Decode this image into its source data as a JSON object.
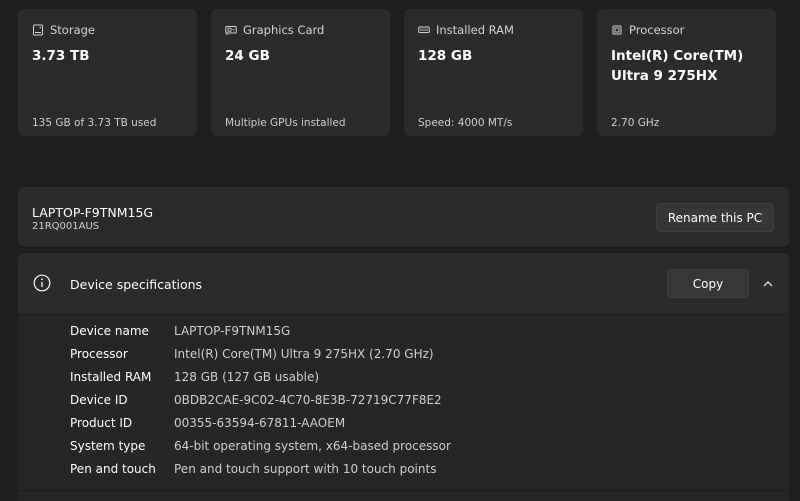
{
  "cards": [
    {
      "title": "Storage",
      "icon": "storage-icon",
      "value": "3.73 TB",
      "sub": "135 GB of 3.73 TB used"
    },
    {
      "title": "Graphics Card",
      "icon": "graphics-card-icon",
      "value": "24 GB",
      "sub": "Multiple GPUs installed"
    },
    {
      "title": "Installed RAM",
      "icon": "ram-icon",
      "value": "128 GB",
      "sub": "Speed: 4000 MT/s"
    },
    {
      "title": "Processor",
      "icon": "processor-icon",
      "value": "Intel(R) Core(TM) Ultra 9 275HX",
      "sub": "2.70 GHz"
    }
  ],
  "pc": {
    "name": "LAPTOP-F9TNM15G",
    "model": "21RQ001AUS",
    "rename_label": "Rename this PC"
  },
  "specs": {
    "title": "Device specifications",
    "copy_label": "Copy",
    "rows": [
      {
        "label": "Device name",
        "value": "LAPTOP-F9TNM15G"
      },
      {
        "label": "Processor",
        "value": "Intel(R) Core(TM) Ultra 9 275HX (2.70 GHz)"
      },
      {
        "label": "Installed RAM",
        "value": "128 GB (127 GB usable)"
      },
      {
        "label": "Device ID",
        "value": "0BDB2CAE-9C02-4C70-8E3B-72719C77F8E2"
      },
      {
        "label": "Product ID",
        "value": "00355-63594-67811-AAOEM"
      },
      {
        "label": "System type",
        "value": "64-bit operating system, x64-based processor"
      },
      {
        "label": "Pen and touch",
        "value": "Pen and touch support with 10 touch points"
      }
    ]
  },
  "colors": {
    "background": "#1e1e21",
    "card": "#2b2b2e",
    "button": "#373739"
  }
}
